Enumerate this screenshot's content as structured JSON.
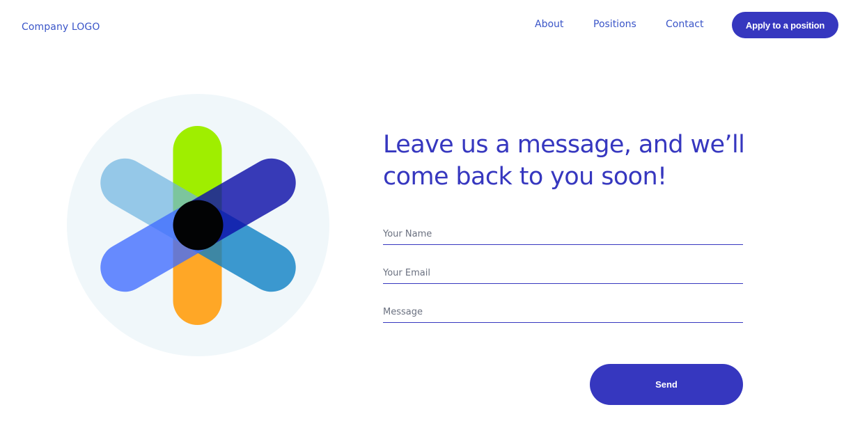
{
  "header": {
    "logo": "Company LOGO",
    "nav": {
      "about": "About",
      "positions": "Positions",
      "contact": "Contact"
    },
    "cta": "Apply to a position"
  },
  "main": {
    "headline": "Leave us a message, and we’ll come back to you soon!",
    "form": {
      "name_placeholder": "Your Name",
      "email_placeholder": "Your Email",
      "message_placeholder": "Message",
      "name_value": "",
      "email_value": "",
      "message_value": "",
      "submit": "Send"
    }
  },
  "colors": {
    "primary": "#3637bf",
    "link": "#3a55c8",
    "illustration_background": "#f0f7fa",
    "lime": "#9fee00",
    "orange": "#ffa726",
    "light_blue": "#8fc8e8",
    "royal_blue": "#4e79ff",
    "indigo": "#1d20b0",
    "cyan": "#1e8fce"
  }
}
